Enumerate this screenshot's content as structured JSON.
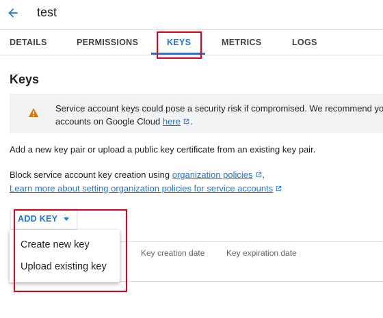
{
  "header": {
    "title": "test",
    "back_icon": "arrow-back-icon"
  },
  "tabs": [
    {
      "label": "DETAILS",
      "active": false
    },
    {
      "label": "PERMISSIONS",
      "active": false
    },
    {
      "label": "KEYS",
      "active": true
    },
    {
      "label": "METRICS",
      "active": false
    },
    {
      "label": "LOGS",
      "active": false
    }
  ],
  "keys": {
    "heading": "Keys",
    "warning": {
      "icon": "warning-icon",
      "line1": "Service account keys could pose a security risk if compromised. We recommend yo",
      "line2_prefix": "accounts on Google Cloud ",
      "link": "here",
      "line2_suffix": "."
    },
    "intro": "Add a new key pair or upload a public key certificate from an existing key pair.",
    "block_prefix": "Block service account key creation using ",
    "block_link": "organization policies",
    "block_suffix": ".",
    "learn_more": "Learn more about setting organization policies for service accounts",
    "add_key": "ADD KEY",
    "menu": [
      "Create new key",
      "Upload existing key"
    ],
    "columns": [
      "Key creation date",
      "Key expiration date"
    ]
  },
  "colors": {
    "accent": "#1a73e8",
    "highlight": "#e0001a",
    "warning": "#e37400"
  }
}
